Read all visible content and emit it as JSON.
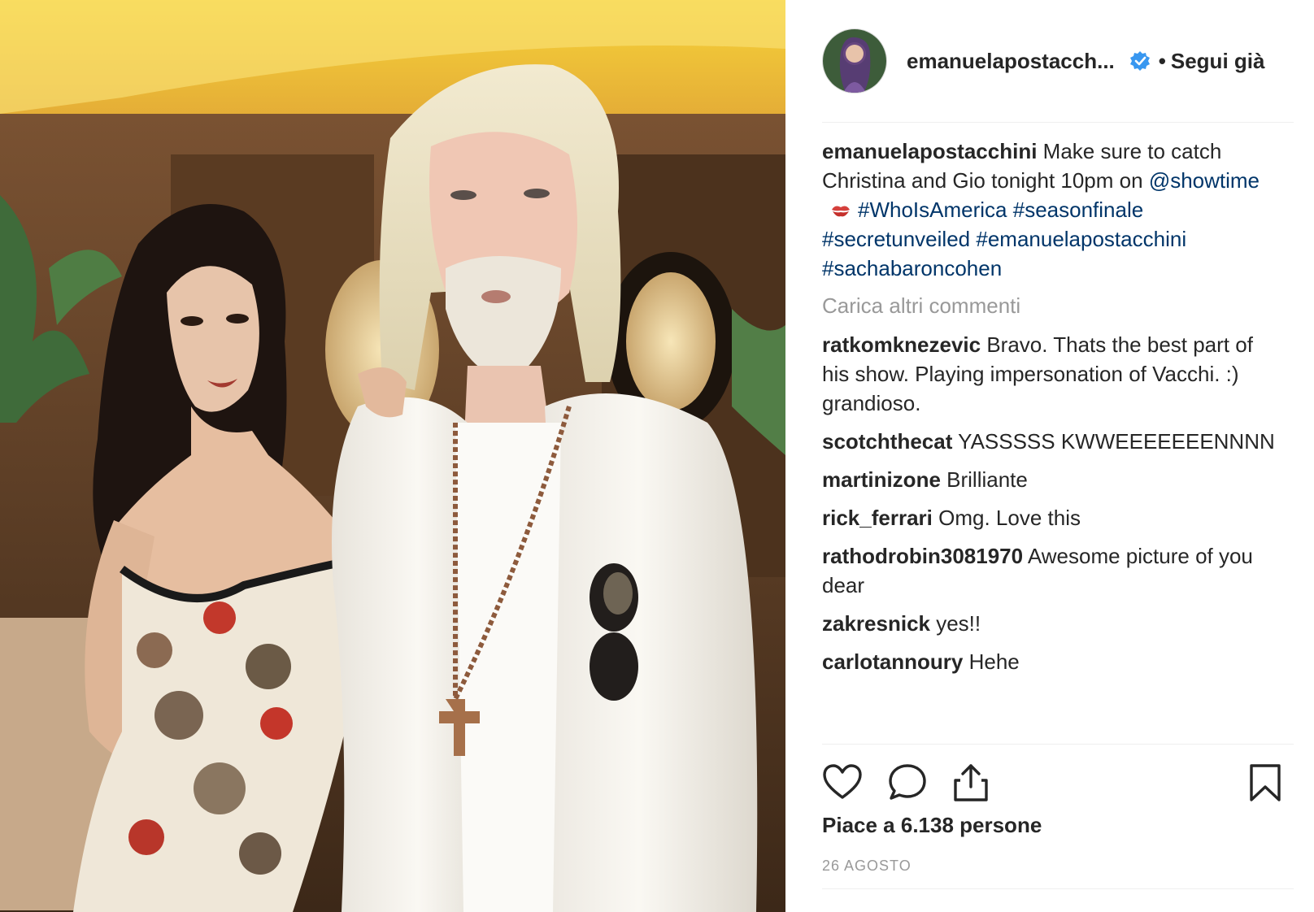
{
  "photo": {
    "alt": ""
  },
  "header": {
    "username": "emanuelapostacch",
    "ellipsis": "...",
    "dot": "•",
    "follow_label": "Segui già"
  },
  "caption": {
    "user": "emanuelapostacchini",
    "text_1": "Make sure to catch Christina and Gio tonight 10pm on",
    "mention": "@showtime",
    "tag_1": "#WhoIsAmerica",
    "tag_2": "#seasonfinale",
    "tag_3": "#secretunveiled",
    "tag_4": "#emanuelapostacchini",
    "tag_5": "#sachabaroncohen"
  },
  "load_more": "Carica altri commenti",
  "comments": [
    {
      "user": "ratkomknezevic",
      "text": "Bravo. Thats the best part of his show. Playing impersonation of Vacchi. :) grandioso."
    },
    {
      "user": "scotchthecat",
      "text": "YASSSSS KWWEEEEEEENNNN"
    },
    {
      "user": "martinizone",
      "text": "Brilliante"
    },
    {
      "user": "rick_ferrari",
      "text": "Omg. Love this"
    },
    {
      "user": "rathodrobin3081970",
      "text": "Awesome picture of you dear"
    },
    {
      "user": "zakresnick",
      "text": "yes!!"
    },
    {
      "user": "carlotannoury",
      "text": "Hehe"
    }
  ],
  "likes_text": "Piace a 6.138 persone",
  "date_text": "26 AGOSTO",
  "icons": {
    "like": "heart-icon",
    "comment": "comment-icon",
    "share": "share-icon",
    "save": "bookmark-icon",
    "verified": "verified-badge-icon"
  },
  "colors": {
    "link": "#003569",
    "muted": "#999999",
    "verified": "#3897f0"
  }
}
